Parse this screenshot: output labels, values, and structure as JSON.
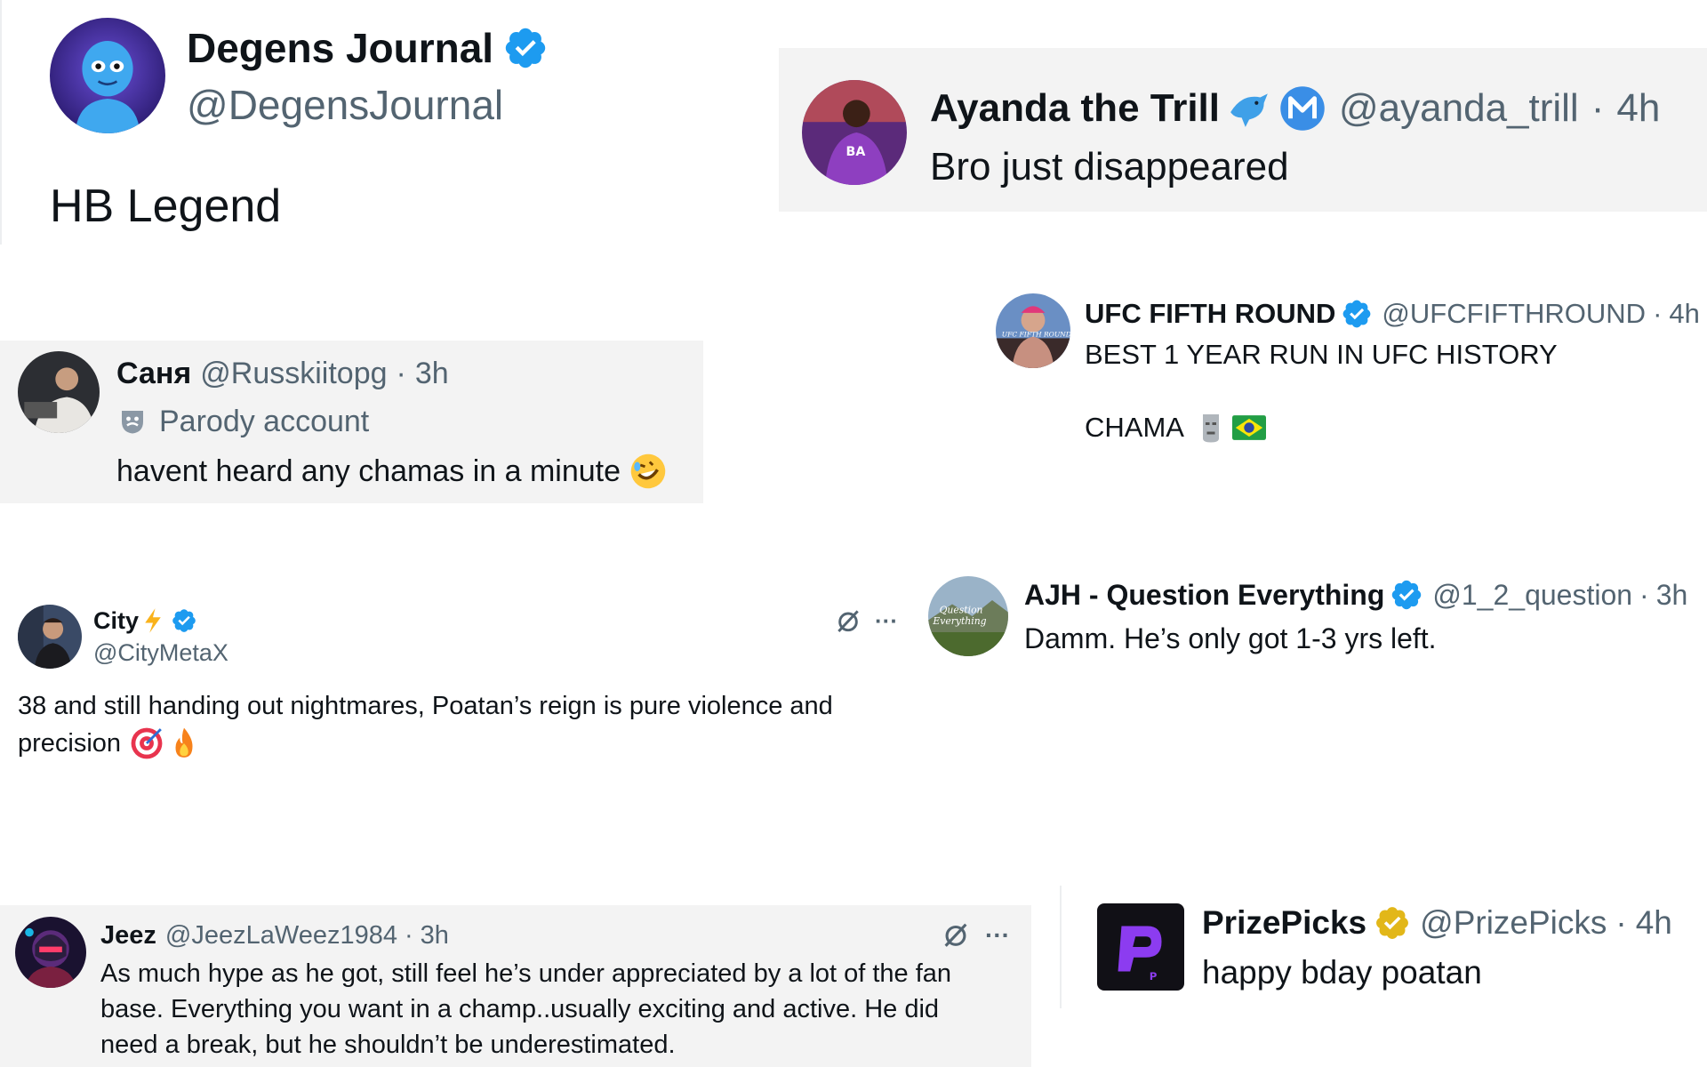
{
  "colors": {
    "verified_blue": "#1d9bf0",
    "verified_gold": "#e2b719",
    "secondary_text": "#536471",
    "card_grey": "#f3f3f3"
  },
  "tweets": {
    "degens": {
      "name": "Degens Journal",
      "handle": "@DegensJournal",
      "text": "HB Legend",
      "badge": "verified-blue-icon"
    },
    "ayanda": {
      "name": "Ayanda the Trill",
      "handle": "@ayanda_trill",
      "sep": "·",
      "time": "4h",
      "text": "Bro just disappeared",
      "name_icons": [
        "dolphin-emoji-icon",
        "m-circle-icon"
      ]
    },
    "sanya": {
      "name": "Саня",
      "handle": "@Russkiitopg",
      "sep": "·",
      "time": "3h",
      "label": "Parody account",
      "label_icon": "mask-icon",
      "text": "havent heard any chamas in a minute",
      "emoji": "rofl-emoji-icon"
    },
    "ufc": {
      "name": "UFC FIFTH ROUND",
      "handle": "@UFCFIFTHROUND",
      "sep": "·",
      "time": "4h",
      "line1": "BEST 1 YEAR RUN IN UFC HISTORY",
      "line2": "CHAMA",
      "emojis": [
        "moai-emoji-icon",
        "brazil-flag-icon"
      ],
      "avatar_text": "UFC FIFTH ROUND"
    },
    "city": {
      "name": "City",
      "handle": "@CityMetaX",
      "name_icons": [
        "lightning-emoji-icon",
        "verified-blue-icon"
      ],
      "line1": "38 and still handing out nightmares, Poatan’s reign is pure violence and",
      "line2": "precision",
      "emojis": [
        "target-emoji-icon",
        "fire-emoji-icon"
      ]
    },
    "ajh": {
      "name": "AJH - Question Everything",
      "handle": "@1_2_question",
      "sep": "·",
      "time": "3h",
      "text": "Damm. He’s only got 1-3 yrs left.",
      "avatar_text_1": "Question",
      "avatar_text_2": "Everything"
    },
    "jeez": {
      "name": "Jeez",
      "handle": "@JeezLaWeez1984",
      "sep": "·",
      "time": "3h",
      "line1": "As much hype as he got, still feel he’s under appreciated by a lot of the fan",
      "line2": "base. Everything you want in a champ..usually exciting and active. He did",
      "line3": "need a break, but he shouldn’t be underestimated."
    },
    "prizepicks": {
      "name": "PrizePicks",
      "handle": "@PrizePicks",
      "sep": "·",
      "time": "4h",
      "text": "happy bday poatan",
      "badge": "verified-gold-icon",
      "logo_letter": "P"
    }
  },
  "toolbar": {
    "more_label": "···",
    "grok_icon": "grok-icon"
  }
}
